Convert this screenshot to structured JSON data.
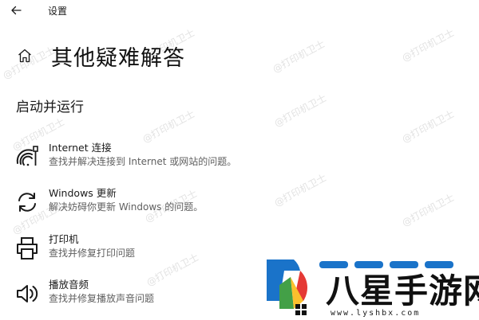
{
  "app": {
    "title": "设置"
  },
  "page": {
    "title": "其他疑难解答"
  },
  "section": {
    "title": "启动并运行"
  },
  "items": [
    {
      "name": "Internet 连接",
      "desc": "查找并解决连接到 Internet 或网站的问题。",
      "icon": "wifi-icon"
    },
    {
      "name": "Windows 更新",
      "desc": "解决妨碍你更新 Windows 的问题。",
      "icon": "refresh-icon"
    },
    {
      "name": "打印机",
      "desc": "查找并修复打印问题",
      "icon": "printer-icon"
    },
    {
      "name": "播放音频",
      "desc": "查找并修复播放声音问题",
      "icon": "speaker-icon"
    }
  ],
  "watermark": {
    "text": "@打印机卫士"
  },
  "logo": {
    "text": "八星手游网",
    "url": "www.lyshbx.com"
  },
  "colors": {
    "accent": "#0067c0",
    "desc": "#5f5f5f"
  }
}
